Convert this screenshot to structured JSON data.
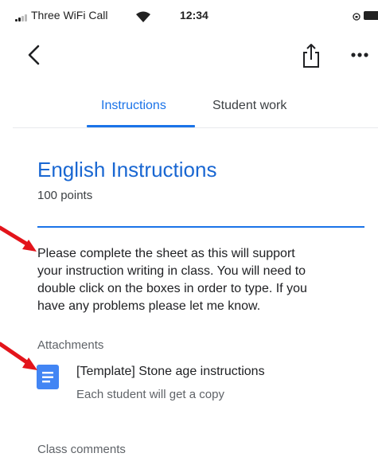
{
  "status_bar": {
    "carrier": "Three WiFi Call",
    "time": "12:34",
    "icons": [
      "signal-icon",
      "wifi-icon",
      "orientation-lock-icon",
      "battery-icon"
    ]
  },
  "app_bar": {
    "icons": [
      "chevron-left-icon",
      "share-icon",
      "more-horizontal-icon"
    ]
  },
  "tabs": [
    {
      "label": "Instructions",
      "selected": true
    },
    {
      "label": "Student work",
      "selected": false
    }
  ],
  "assignment": {
    "title": "English Instructions",
    "points": "100 points",
    "description_lines": [
      "Please complete the sheet as this will support",
      "your instruction writing in class.  You will need to",
      "double click on the boxes in order to type.  If you",
      "have any problems please let me know."
    ]
  },
  "attachments": {
    "label": "Attachments",
    "items": [
      {
        "title": "[Template] Stone age instructions",
        "subtitle": "Each student will get a copy",
        "icon": "google-docs-icon"
      }
    ]
  },
  "comments": {
    "label": "Class comments"
  },
  "colors": {
    "accent": "#1a73e8",
    "title": "#1967d2",
    "annotation": "#e3141b",
    "doc_icon": "#4285f4"
  }
}
